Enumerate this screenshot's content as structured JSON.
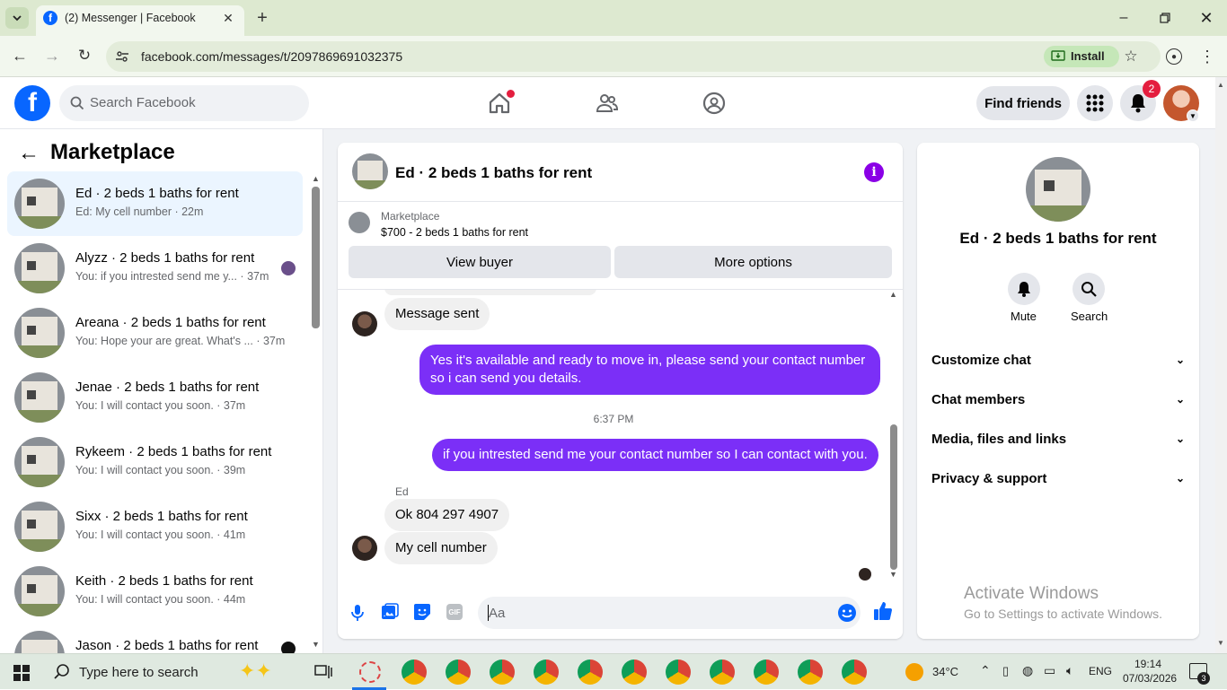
{
  "browser": {
    "tab_title": "(2) Messenger | Facebook",
    "url": "facebook.com/messages/t/2097869691032375",
    "install_label": "Install"
  },
  "fb": {
    "search_placeholder": "Search Facebook",
    "find_friends": "Find friends",
    "notif_count": "2"
  },
  "left": {
    "title": "Marketplace",
    "conversations": [
      {
        "name": "Ed · 2 beds 1 baths for rent",
        "preview": "Ed: My cell number · 22m"
      },
      {
        "name": "Alyzz · 2 beds 1 baths for rent",
        "preview": "You: if you intrested send me y... · 37m"
      },
      {
        "name": "Areana · 2 beds 1 baths for rent",
        "preview": "You: Hope your are great. What's ... · 37m"
      },
      {
        "name": "Jenae · 2 beds 1 baths for rent",
        "preview": "You: I will contact you soon. · 37m"
      },
      {
        "name": "Rykeem · 2 beds 1 baths for rent",
        "preview": "You: I will contact you soon. · 39m"
      },
      {
        "name": "Sixx · 2 beds 1 baths for rent",
        "preview": "You: I will contact you soon. · 41m"
      },
      {
        "name": "Keith · 2 beds 1 baths for rent",
        "preview": "You: I will contact you soon. · 44m"
      },
      {
        "name": "Jason · 2 beds 1 baths for rent",
        "preview": ""
      }
    ]
  },
  "chat": {
    "title": "Ed · 2 beds 1 baths for rent",
    "listing_source": "Marketplace",
    "listing": "$700 - 2 beds 1 baths for rent",
    "view_buyer": "View buyer",
    "more_options": "More options",
    "messages": {
      "m1": "Message sent",
      "m2": "Yes it's available and ready to move in, please send your contact number so i can send you details.",
      "time": "6:37 PM",
      "m3": "if you intrested send me your contact number so I can contact with you.",
      "sender": "Ed",
      "m4": "Ok 804 297 4907",
      "m5": "My cell number"
    },
    "composer_placeholder": "Aa",
    "gif_label": "GIF"
  },
  "right": {
    "name": "Ed · 2 beds 1 baths for rent",
    "mute": "Mute",
    "search": "Search",
    "sections": [
      "Customize chat",
      "Chat members",
      "Media, files and links",
      "Privacy & support"
    ],
    "watermark_title": "Activate Windows",
    "watermark_sub": "Go to Settings to activate Windows."
  },
  "taskbar": {
    "search_placeholder": "Type here to search",
    "temp": "34°C",
    "lang": "ENG",
    "time": "19:14",
    "date": "07/03/2026",
    "notif": "3"
  },
  "colors": {
    "fb_blue": "#0866ff",
    "messenger_purple": "#7b2ff7",
    "notif_red": "#e41e3f"
  }
}
